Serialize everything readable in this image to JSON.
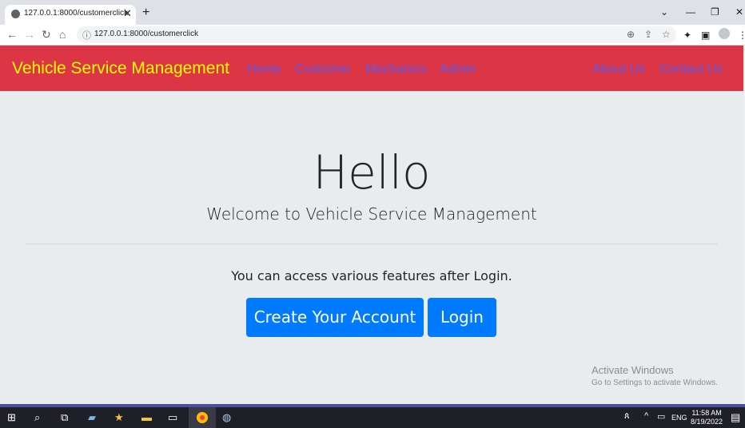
{
  "browser": {
    "tab_title": "127.0.0.1:8000/customerclick",
    "url": "127.0.0.1:8000/customerclick",
    "new_tab": "+",
    "tab_close": "✕"
  },
  "navbar": {
    "brand": "Vehicle Service Management",
    "links_left": [
      "Home",
      "Customer",
      "Mechanics",
      "Admin"
    ],
    "links_right": [
      "About Us",
      "Contact Us"
    ]
  },
  "main": {
    "heading": "Hello",
    "subheading": "Welcome to Vehicle Service Management",
    "lead": "You can access various features after Login.",
    "create_account": "Create Your Account",
    "login": "Login"
  },
  "watermark": {
    "title": "Activate Windows",
    "subtitle": "Go to Settings to activate Windows."
  },
  "taskbar": {
    "language": "ENG",
    "time": "11:58 AM",
    "date": "8/19/2022"
  },
  "colors": {
    "navbar_bg": "#dc3545",
    "brand": "#ffff00",
    "button": "#007bff"
  }
}
